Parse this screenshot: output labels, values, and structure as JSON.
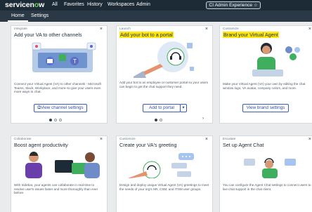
{
  "topbar": {
    "logo_prefix": "servicen",
    "logo_o": "o",
    "logo_suffix": "w",
    "nav": [
      "All",
      "Favorites",
      "History",
      "Workspaces",
      "Admin"
    ],
    "workspace_pill": "CI Admin Experience",
    "star": "☆"
  },
  "subnav": {
    "home": "Home",
    "settings": "Settings"
  },
  "cards": [
    {
      "category": "Integrate",
      "title": "Add your VA to other channels",
      "description": "Connect your Virtual Agent (VA) to other channels - Microsoft Teams, Slack, Workplace, and more–to give your users even more ways to chat.",
      "button": "View channel settings",
      "close": "×"
    },
    {
      "category": "Launch",
      "title": "Add your bot to a portal",
      "description": "Add your bot to an employee or customer portal so your users can begin to get the chat support they need.",
      "button": "Add to portal",
      "close": "×"
    },
    {
      "category": "Customize",
      "title": "Brand your Virtual Agent",
      "description": "Make your Virtual Agent (VA) your own by editing the chat window logo, VA avatar, company colors, and more.",
      "button": "View brand settings",
      "close": "×"
    },
    {
      "category": "Collaborate",
      "title": "Boost agent productivity",
      "description": "With Sidebar, your agents can collaborate in real-time to resolve user's issues faster and more thoroughly than ever before.",
      "close": "×"
    },
    {
      "category": "Customize",
      "title": "Create your VA's greeting",
      "description": "Design and deploy unique Virtual Agent (VA) greetings to meet the needs of your org's HR, CSM, and ITSM user groups.",
      "close": "×"
    },
    {
      "category": "Escalate",
      "title": "Set up Agent Chat",
      "description": "You can configure the Agent Chat settings to connect users to live chat support in the chat client.",
      "close": "×"
    }
  ],
  "colors": {
    "nav_bg": "#1d2b36",
    "subnav_bg": "#2a3945",
    "accent_blue": "#3b5bb8",
    "highlight": "#ffe70a",
    "brand_green": "#62d84e",
    "illus_green": "#3fae5d"
  },
  "icons": [
    "close-icon",
    "star-icon",
    "caret-down-icon",
    "external-link-icon"
  ]
}
